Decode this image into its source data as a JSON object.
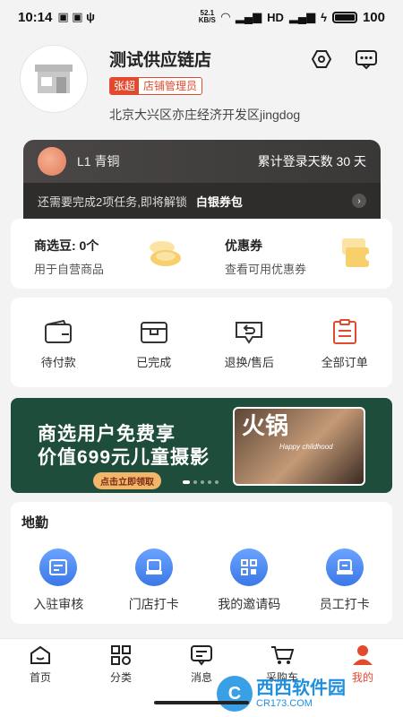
{
  "status_bar": {
    "time": "10:14",
    "net_speed_top": "52.1",
    "net_speed_bottom": "KB/S",
    "battery": "100"
  },
  "profile": {
    "shop_name": "测试供应链店",
    "user_name": "张超",
    "role": "店铺管理员",
    "address": "北京大兴区亦庄经济开发区jingdog"
  },
  "member": {
    "level": "L1 青铜",
    "login_days": "累计登录天数 30 天",
    "task_text": "还需要完成2项任务,即将解锁",
    "reward": "白银券包"
  },
  "assets": [
    {
      "title": "商选豆: 0个",
      "subtitle": "用于自营商品"
    },
    {
      "title": "优惠券",
      "subtitle": "查看可用优惠券"
    }
  ],
  "orders": [
    {
      "label": "待付款",
      "icon": "wallet-icon"
    },
    {
      "label": "已完成",
      "icon": "box-icon"
    },
    {
      "label": "退换/售后",
      "icon": "return-icon"
    },
    {
      "label": "全部订单",
      "icon": "order-list-icon"
    }
  ],
  "banner": {
    "line1": "商选用户免费享",
    "line2": "价值699元儿童摄影",
    "cta": "点击立即领取",
    "photo_title": "火锅",
    "photo_caption": "Happy childhood"
  },
  "field_service": {
    "title": "地勤",
    "items": [
      {
        "label": "入驻审核",
        "icon": "review-icon"
      },
      {
        "label": "门店打卡",
        "icon": "store-checkin-icon"
      },
      {
        "label": "我的邀请码",
        "icon": "qrcode-icon"
      },
      {
        "label": "员工打卡",
        "icon": "staff-checkin-icon"
      }
    ]
  },
  "tabs": [
    {
      "label": "首页",
      "icon": "home-icon"
    },
    {
      "label": "分类",
      "icon": "category-icon"
    },
    {
      "label": "消息",
      "icon": "message-icon"
    },
    {
      "label": "采购车",
      "icon": "cart-icon"
    },
    {
      "label": "我的",
      "icon": "profile-icon",
      "active": true
    }
  ],
  "watermark": {
    "logo": "C",
    "brand": "西西软件园",
    "site": "CR173.COM"
  },
  "colors": {
    "accent": "#e24a2e",
    "member_bg": "#3f3d3c",
    "banner_bg": "#1f4d3c",
    "field_icon": "#3b78e7"
  }
}
